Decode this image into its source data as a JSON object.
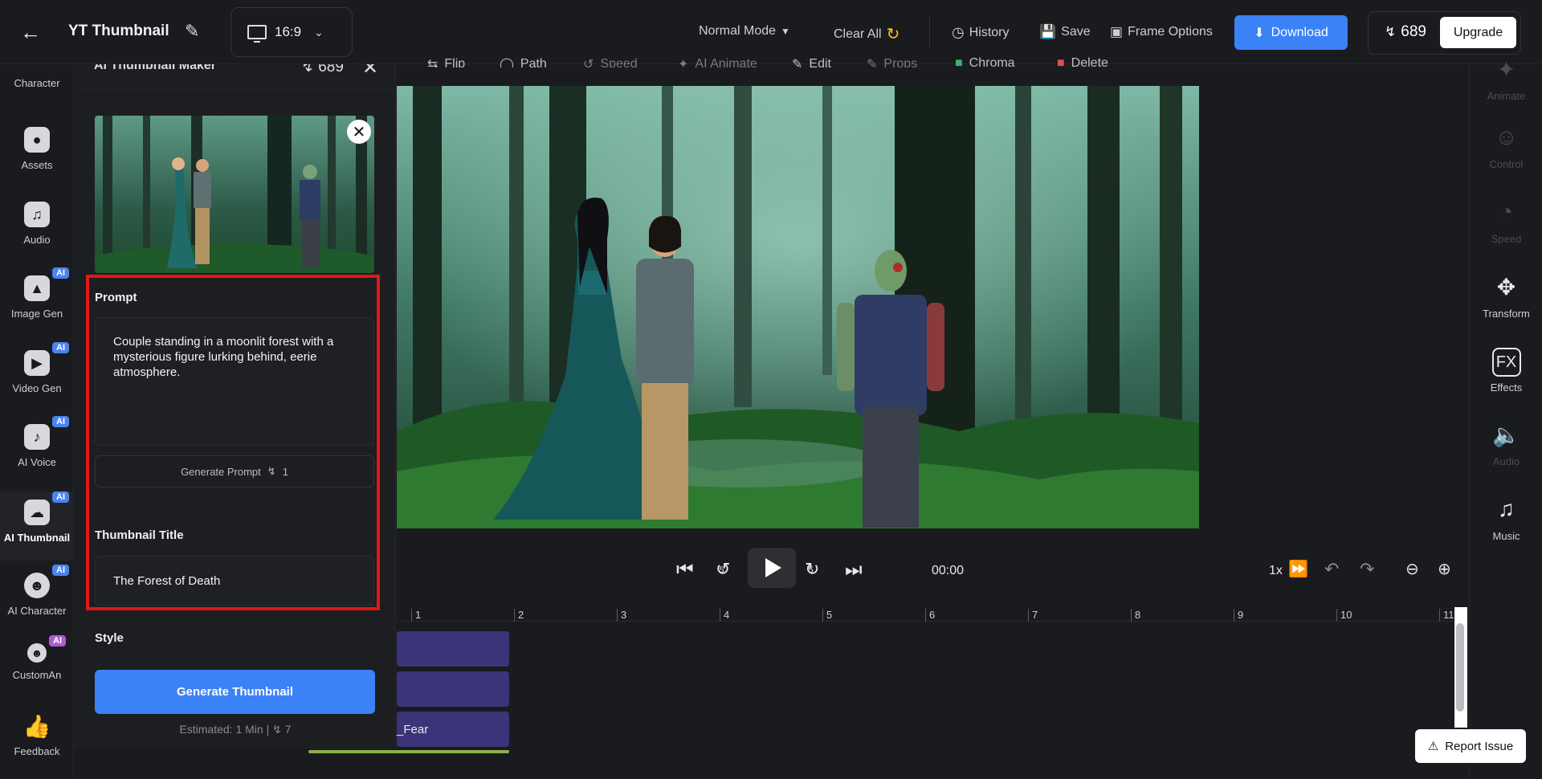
{
  "header": {
    "project_title": "YT Thumbnail",
    "aspect_ratio": "16:9",
    "mode": "Normal Mode",
    "clear_all": "Clear All",
    "history": "History",
    "save": "Save",
    "frame_options": "Frame Options",
    "download": "Download",
    "credits": "689",
    "upgrade": "Upgrade"
  },
  "left_rail": [
    {
      "label": "Character",
      "icon": "character-icon",
      "badge": ""
    },
    {
      "label": "Assets",
      "icon": "assets-icon",
      "badge": ""
    },
    {
      "label": "Audio",
      "icon": "music-note-icon",
      "badge": ""
    },
    {
      "label": "Image Gen",
      "icon": "image-gen-icon",
      "badge": "AI"
    },
    {
      "label": "Video Gen",
      "icon": "video-gen-icon",
      "badge": "AI"
    },
    {
      "label": "AI Voice",
      "icon": "voice-icon",
      "badge": "AI"
    },
    {
      "label": "AI Thumbnail",
      "icon": "thumbnail-icon",
      "badge": "AI"
    },
    {
      "label": "AI Character",
      "icon": "ai-character-icon",
      "badge": "AI"
    },
    {
      "label": "CustomAn",
      "icon": "custom-anim-icon",
      "badge": "AI"
    },
    {
      "label": "Feedback",
      "icon": "thumbs-up-icon",
      "badge": ""
    }
  ],
  "panel": {
    "title": "AI Thumbnail Maker",
    "credits": "689",
    "prompt_label": "Prompt",
    "prompt_value": "Couple standing in a moonlit forest with a mysterious figure lurking behind, eerie atmosphere.",
    "generate_prompt": "Generate Prompt",
    "generate_prompt_cost": "1",
    "title_label": "Thumbnail Title",
    "title_value": "The Forest of Death",
    "style_label": "Style",
    "generate_button": "Generate Thumbnail",
    "estimate": "Estimated: 1 Min",
    "estimate_cost": "7"
  },
  "actions": [
    {
      "label": "Flip",
      "enabled": true
    },
    {
      "label": "Path",
      "enabled": true
    },
    {
      "label": "Speed",
      "enabled": false
    },
    {
      "label": "AI Animate",
      "enabled": false
    },
    {
      "label": "Edit",
      "enabled": true
    },
    {
      "label": "Props",
      "enabled": false
    },
    {
      "label": "Chroma",
      "enabled": true
    },
    {
      "label": "Delete",
      "enabled": true
    }
  ],
  "right_rail": [
    {
      "label": "Animate",
      "enabled": false
    },
    {
      "label": "Control",
      "enabled": false
    },
    {
      "label": "Speed",
      "enabled": false
    },
    {
      "label": "Transform",
      "enabled": true
    },
    {
      "label": "Effects",
      "enabled": true
    },
    {
      "label": "Audio",
      "enabled": false
    },
    {
      "label": "Music",
      "enabled": true
    }
  ],
  "playback": {
    "time": "00:00",
    "speed": "1x",
    "skip_back": "5",
    "skip_forward": "5"
  },
  "timeline": {
    "ticks": [
      "1",
      "2",
      "3",
      "4",
      "5",
      "6",
      "7",
      "8",
      "9",
      "10",
      "11"
    ],
    "clips": [
      "",
      "",
      "_Fear"
    ]
  },
  "report_issue": "Report Issue",
  "colors": {
    "accent": "#3b82f6",
    "highlight": "#e11818",
    "clip": "#3c3478"
  }
}
